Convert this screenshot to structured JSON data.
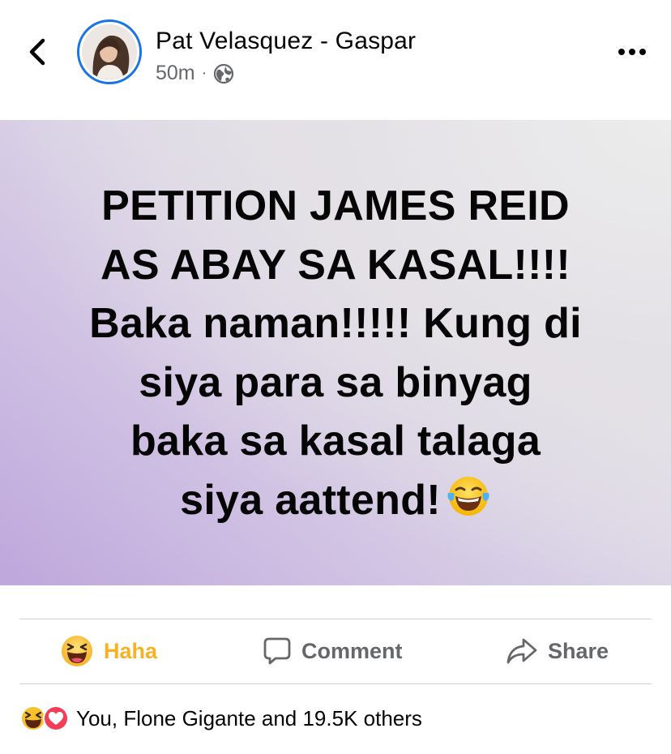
{
  "post": {
    "author_name": "Pat Velasquez - Gaspar",
    "time": "50m",
    "separator": "·",
    "privacy_icon": "globe-icon",
    "more_icon": "more-dots-icon",
    "back_icon": "chevron-left-icon"
  },
  "status_card": {
    "line1": "PETITION JAMES REID",
    "line2": "AS ABAY SA KASAL!!!!",
    "line3": "Baka naman!!!!! Kung di",
    "line4": "siya para sa binyag",
    "line5": "baka sa kasal talaga",
    "line6": "siya aattend!",
    "trailing_emoji": "laughing-tears-emoji",
    "background_colors": [
      "#bea7dc",
      "#dcd6e6",
      "#ececec"
    ]
  },
  "actions": {
    "haha_label": "Haha",
    "comment_label": "Comment",
    "share_label": "Share",
    "haha_color": "#f7b125"
  },
  "reactions": {
    "icons": [
      "haha-reaction-icon",
      "love-reaction-icon"
    ],
    "summary": "You, Flone Gigante and 19.5K others"
  }
}
